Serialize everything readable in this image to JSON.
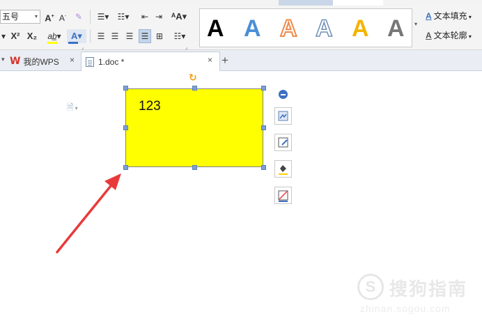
{
  "ribbon": {
    "font_size": "五号",
    "gallery_letters": [
      "A",
      "A",
      "A",
      "A",
      "A",
      "A"
    ],
    "text_fill_label": "文本填充",
    "text_outline_label": "文本轮廓"
  },
  "tabs": {
    "home_label": "我的WPS",
    "doc_label": "1.doc *",
    "close_glyph": "×",
    "add_glyph": "+"
  },
  "document": {
    "textbox_text": "123"
  },
  "watermark": {
    "logo_char": "S",
    "name": "搜狗指南",
    "url": "zhinan.sogou.com"
  },
  "colors": {
    "textbox_fill": "#ffff00",
    "selection_handle": "#7f9fd3",
    "arrow": "#e83a3a",
    "accent_blue": "#3b6fc2",
    "wps_red": "#d8312a"
  }
}
